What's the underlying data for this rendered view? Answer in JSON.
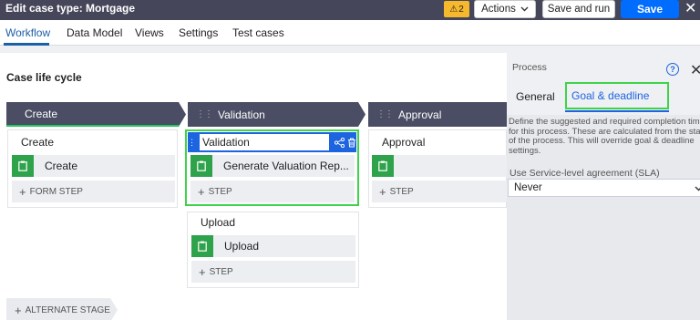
{
  "header": {
    "title": "Edit case type: Mortgage",
    "warning_count": "2",
    "actions_label": "Actions",
    "save_and_run_label": "Save and run",
    "save_label": "Save"
  },
  "tabs": [
    {
      "label": "Workflow",
      "active": true
    },
    {
      "label": "Data Model"
    },
    {
      "label": "Views"
    },
    {
      "label": "Settings"
    },
    {
      "label": "Test cases"
    }
  ],
  "lifecycle": {
    "title": "Case life cycle",
    "alternate_stage_label": "ALTERNATE STAGE",
    "stages": [
      {
        "name": "Create",
        "processes": [
          {
            "name": "Create",
            "steps": [
              "Create"
            ],
            "add_label": "FORM STEP"
          }
        ]
      },
      {
        "name": "Validation",
        "processes": [
          {
            "name": "Validation",
            "steps": [
              "Generate Valuation Rep..."
            ],
            "add_label": "STEP"
          },
          {
            "name": "Upload",
            "steps": [
              "Upload"
            ],
            "add_label": "STEP"
          }
        ]
      },
      {
        "name": "Approval",
        "processes": [
          {
            "name": "Approval",
            "steps": [
              ""
            ],
            "add_label": "STEP"
          }
        ]
      }
    ]
  },
  "panel": {
    "label": "Process",
    "tabs": [
      {
        "label": "General"
      },
      {
        "label": "Goal & deadline",
        "active": true
      }
    ],
    "description": "Define the suggested and required completion time\nfor this process. These are calculated from the start\nof the process. This will override goal & deadline\nsettings.",
    "sla_label": "Use Service-level agreement (SLA)",
    "sla_value": "Never"
  },
  "colors": {
    "topbar": "#454659",
    "accent_blue": "#006dff",
    "highlight_green": "#3fd34b",
    "step_icon_green": "#2fa34c",
    "warning": "#f6b82c"
  }
}
